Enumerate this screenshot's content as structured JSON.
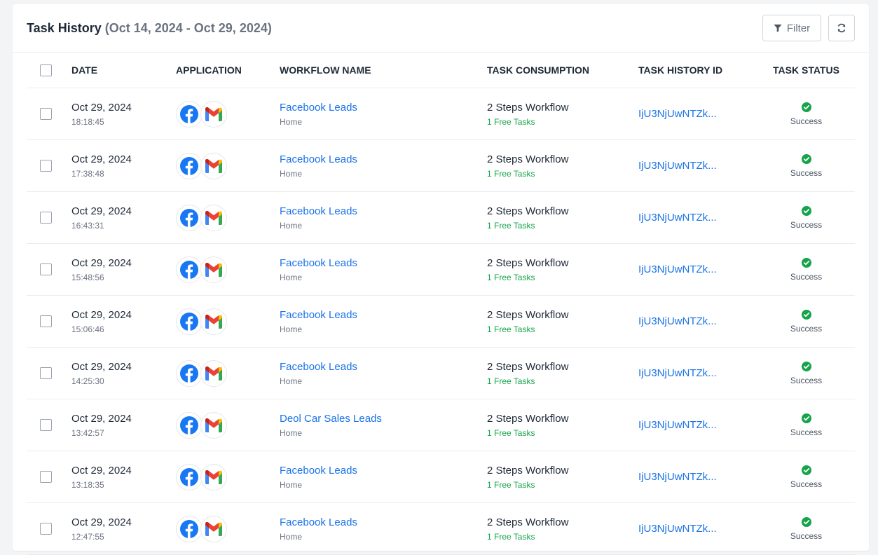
{
  "header": {
    "title": "Task History",
    "date_range": "(Oct 14, 2024 - Oct 29, 2024)",
    "filter_label": "Filter"
  },
  "columns": {
    "date": "DATE",
    "application": "APPLICATION",
    "workflow_name": "WORKFLOW NAME",
    "task_consumption": "TASK CONSUMPTION",
    "task_history_id": "TASK HISTORY ID",
    "task_status": "TASK STATUS"
  },
  "colors": {
    "link": "#1a73e8",
    "success": "#16a34a",
    "facebook": "#1877f2"
  },
  "rows": [
    {
      "date": "Oct 29, 2024",
      "time": "18:18:45",
      "workflow": "Facebook Leads",
      "folder": "Home",
      "consumption": "2 Steps Workflow",
      "tasks": "1 Free Tasks",
      "history_id": "IjU3NjUwNTZk...",
      "status": "Success"
    },
    {
      "date": "Oct 29, 2024",
      "time": "17:38:48",
      "workflow": "Facebook Leads",
      "folder": "Home",
      "consumption": "2 Steps Workflow",
      "tasks": "1 Free Tasks",
      "history_id": "IjU3NjUwNTZk...",
      "status": "Success"
    },
    {
      "date": "Oct 29, 2024",
      "time": "16:43:31",
      "workflow": "Facebook Leads",
      "folder": "Home",
      "consumption": "2 Steps Workflow",
      "tasks": "1 Free Tasks",
      "history_id": "IjU3NjUwNTZk...",
      "status": "Success"
    },
    {
      "date": "Oct 29, 2024",
      "time": "15:48:56",
      "workflow": "Facebook Leads",
      "folder": "Home",
      "consumption": "2 Steps Workflow",
      "tasks": "1 Free Tasks",
      "history_id": "IjU3NjUwNTZk...",
      "status": "Success"
    },
    {
      "date": "Oct 29, 2024",
      "time": "15:06:46",
      "workflow": "Facebook Leads",
      "folder": "Home",
      "consumption": "2 Steps Workflow",
      "tasks": "1 Free Tasks",
      "history_id": "IjU3NjUwNTZk...",
      "status": "Success"
    },
    {
      "date": "Oct 29, 2024",
      "time": "14:25:30",
      "workflow": "Facebook Leads",
      "folder": "Home",
      "consumption": "2 Steps Workflow",
      "tasks": "1 Free Tasks",
      "history_id": "IjU3NjUwNTZk...",
      "status": "Success"
    },
    {
      "date": "Oct 29, 2024",
      "time": "13:42:57",
      "workflow": "Deol Car Sales Leads",
      "folder": "Home",
      "consumption": "2 Steps Workflow",
      "tasks": "1 Free Tasks",
      "history_id": "IjU3NjUwNTZk...",
      "status": "Success"
    },
    {
      "date": "Oct 29, 2024",
      "time": "13:18:35",
      "workflow": "Facebook Leads",
      "folder": "Home",
      "consumption": "2 Steps Workflow",
      "tasks": "1 Free Tasks",
      "history_id": "IjU3NjUwNTZk...",
      "status": "Success"
    },
    {
      "date": "Oct 29, 2024",
      "time": "12:47:55",
      "workflow": "Facebook Leads",
      "folder": "Home",
      "consumption": "2 Steps Workflow",
      "tasks": "1 Free Tasks",
      "history_id": "IjU3NjUwNTZk...",
      "status": "Success"
    }
  ]
}
